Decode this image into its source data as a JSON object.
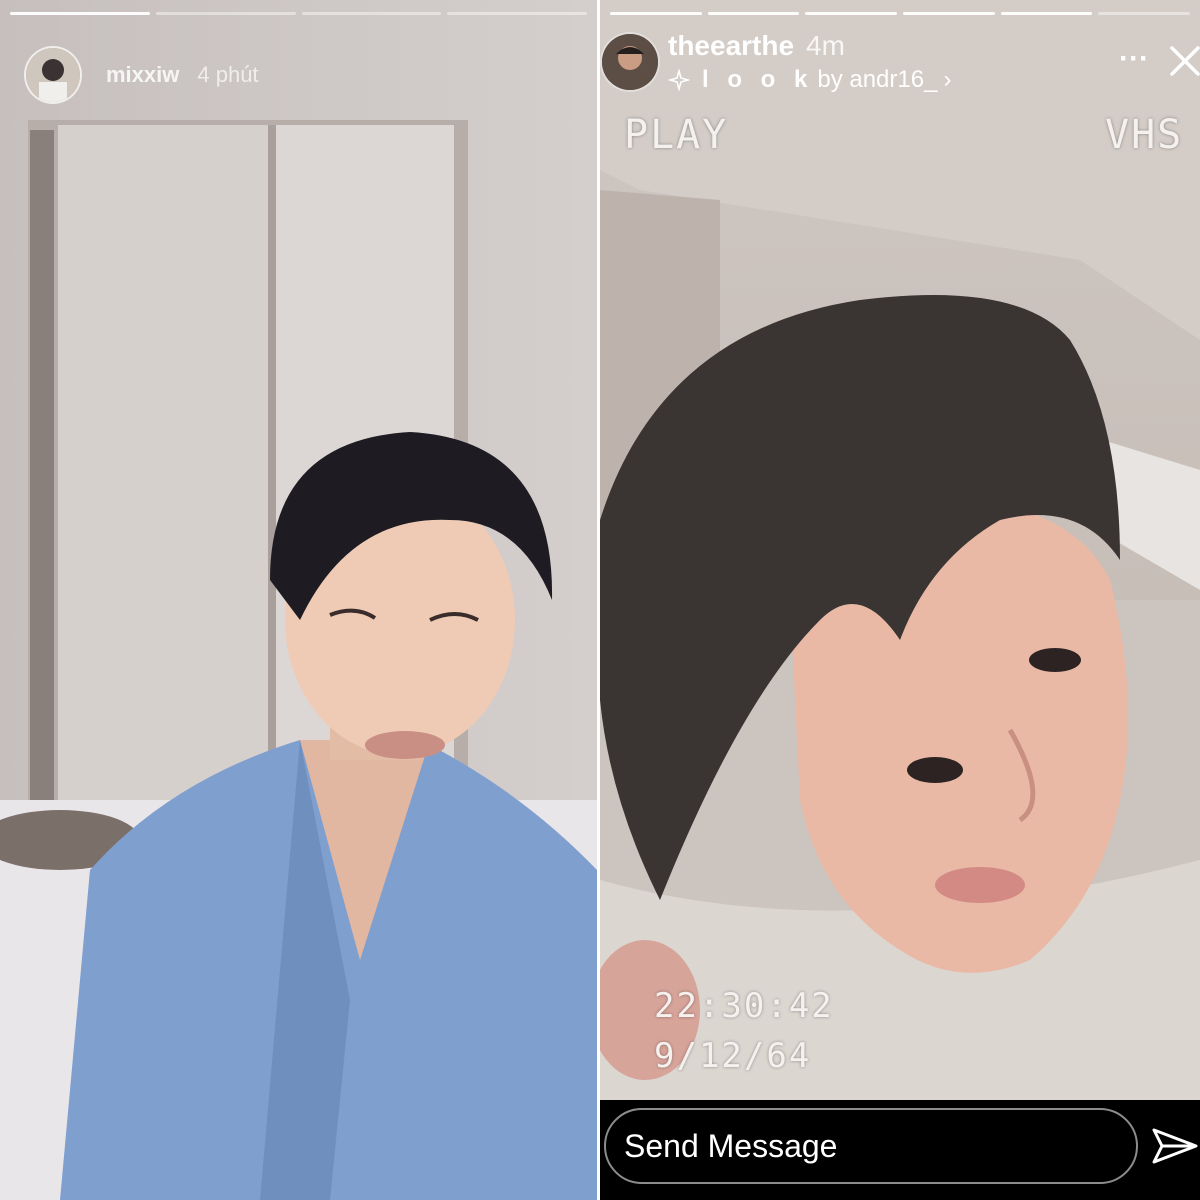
{
  "left_story": {
    "username": "mixxiw",
    "time": "4 phút",
    "progress": {
      "segments_total": 4,
      "segments_done": 1
    }
  },
  "right_story": {
    "username": "theearthe",
    "time": "4m",
    "filter": {
      "sparkle_icon": "sparkle-icon",
      "name": "l o o k",
      "by": "by andr16_",
      "chevron": "›"
    },
    "more_label": "···",
    "close_icon": "close-icon",
    "progress": {
      "segments_total": 6,
      "segments_done": 5
    },
    "overlay": {
      "play_label": "PLAY",
      "vhs_label": "VHS",
      "clock": "22:30:42",
      "date": "9/12/64"
    },
    "message_bar": {
      "placeholder": "Send Message",
      "send_icon": "paper-plane-icon"
    }
  },
  "colors": {
    "overlay_text": "#f4f1ee",
    "message_bar_bg": "#000000"
  }
}
